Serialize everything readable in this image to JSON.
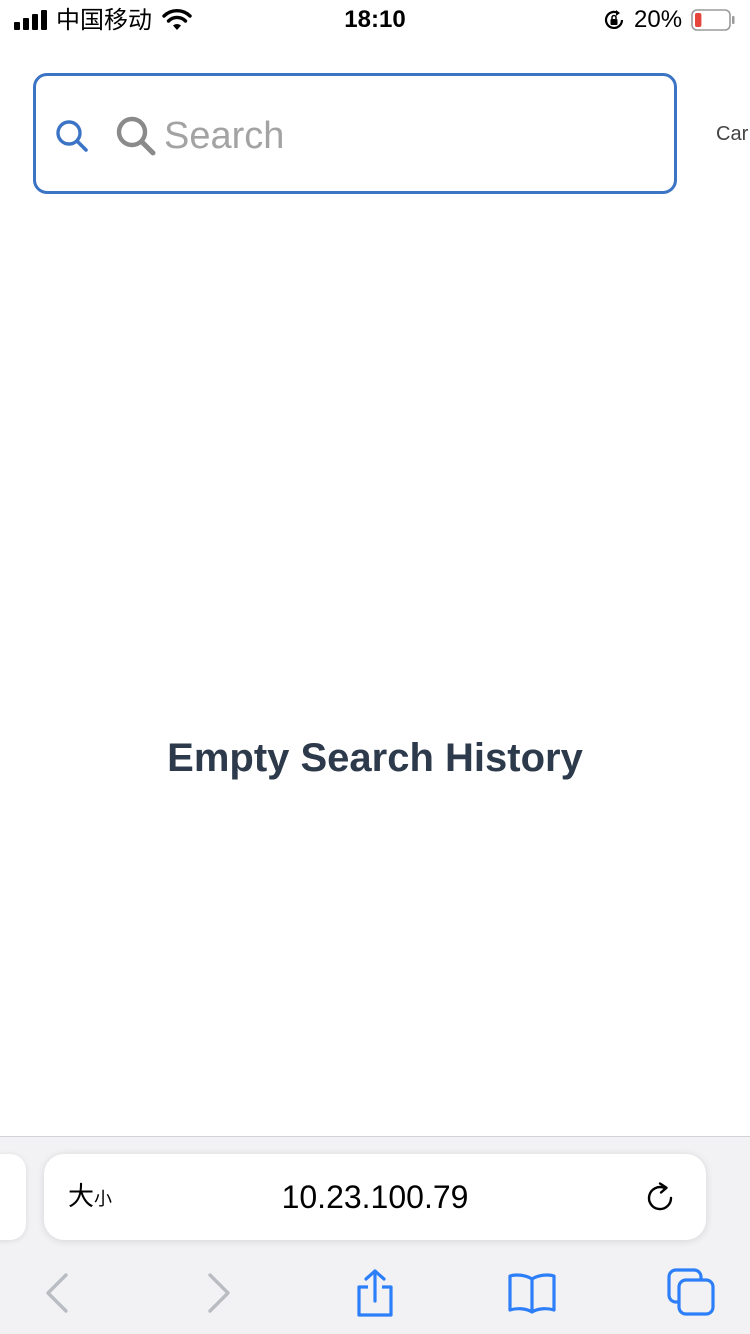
{
  "status_bar": {
    "carrier": "中国移动",
    "time": "18:10",
    "battery_percent": "20%",
    "battery_level": 0.2,
    "battery_color": "#e5453a"
  },
  "search": {
    "placeholder": "Search",
    "value": "",
    "cancel_label": "Car",
    "border_color": "#3b74c4"
  },
  "main": {
    "empty_message": "Empty Search History"
  },
  "browser": {
    "text_size_big": "大",
    "text_size_small": "小",
    "url": "10.23.100.79",
    "accent_color": "#2d7ff9"
  },
  "icons": {
    "status": [
      "signal-icon",
      "wifi-icon",
      "orientation-lock-icon",
      "battery-icon"
    ],
    "search": [
      "search-icon"
    ],
    "address_bar": [
      "reload-icon"
    ],
    "toolbar": [
      "back-icon",
      "forward-icon",
      "share-icon",
      "bookmarks-icon",
      "tabs-icon"
    ]
  }
}
